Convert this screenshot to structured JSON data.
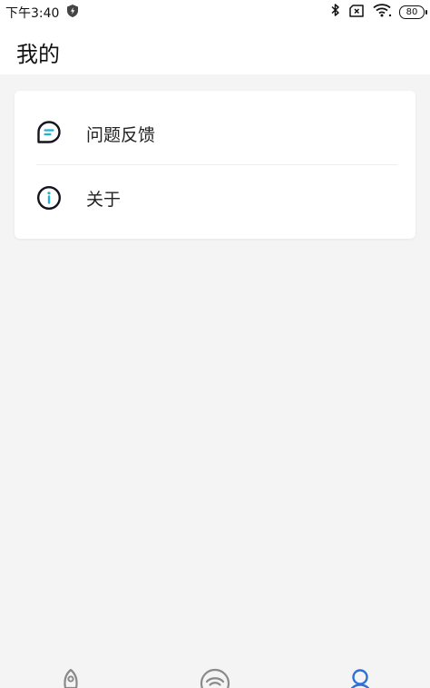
{
  "status_bar": {
    "time": "下午3:40",
    "battery": "80",
    "icons": [
      "shield-bolt-icon",
      "bluetooth-icon",
      "no-sim-icon",
      "wifi-icon",
      "battery-icon"
    ]
  },
  "header": {
    "title": "我的"
  },
  "menu": {
    "items": [
      {
        "label": "问题反馈",
        "icon": "feedback-icon"
      },
      {
        "label": "关于",
        "icon": "info-icon"
      }
    ]
  },
  "bottom_nav": {
    "tabs": [
      {
        "icon": "rocket-icon",
        "active": false
      },
      {
        "icon": "wifi-icon",
        "active": false
      },
      {
        "icon": "user-icon",
        "active": true
      }
    ],
    "active_color": "#2f6fd6",
    "inactive_color": "#8a8a8a"
  },
  "colors": {
    "background": "#f4f4f4",
    "card": "#ffffff",
    "accent_cyan": "#1cb5d8",
    "accent_blue": "#2f6fd6"
  }
}
